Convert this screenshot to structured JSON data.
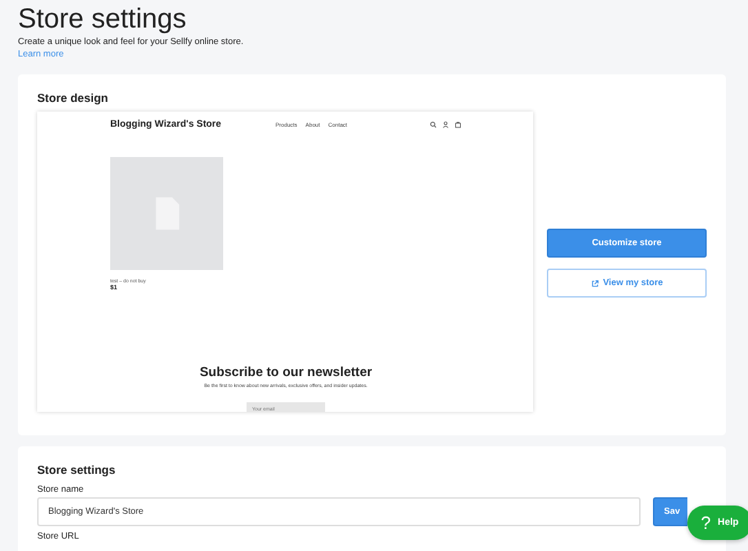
{
  "page": {
    "title": "Store settings",
    "description": "Create a unique look and feel for your Sellfy online store.",
    "link": "Learn more"
  },
  "store_design": {
    "heading": "Store design",
    "preview": {
      "store_name": "Blogging Wizard's Store",
      "nav": [
        "Products",
        "About",
        "Contact"
      ],
      "product": {
        "name": "test – do not buy",
        "price": "$1"
      },
      "newsletter": {
        "heading": "Subscribe to our newsletter",
        "text": "Be the first to know about new arrivals, exclusive offers, and insider updates.",
        "placeholder": "Your email"
      }
    },
    "buttons": [
      {
        "label": "Customize store",
        "kind": "primary"
      },
      {
        "label": "View my store",
        "kind": "outline"
      }
    ]
  },
  "store_settings": {
    "heading": "Store settings",
    "fields": [
      {
        "label": "Store name",
        "value": "Blogging Wizard's Store",
        "button": "Sav"
      },
      {
        "label": "Store URL"
      }
    ]
  },
  "help": {
    "icon": "?",
    "label": "Help"
  }
}
